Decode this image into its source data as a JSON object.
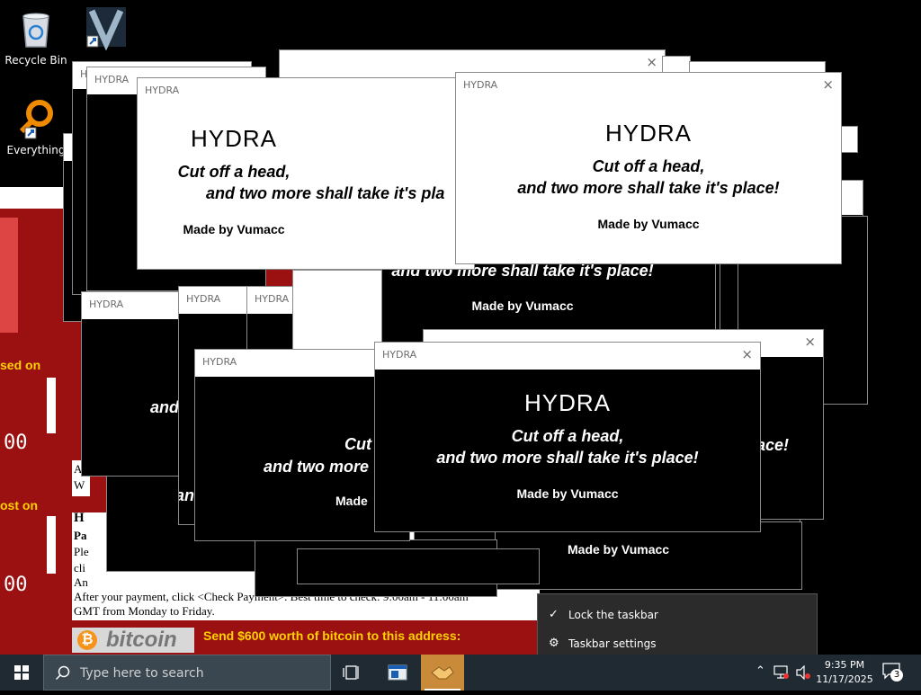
{
  "desktop": {
    "icons": [
      {
        "label": "Recycle Bin",
        "icon": "recycle-bin-icon"
      },
      {
        "label": "",
        "icon": "media-player-shortcut-icon"
      },
      {
        "label": "Everything",
        "icon": "everything-search-icon"
      }
    ]
  },
  "ransom": {
    "raised_label": "sed on",
    "lost_label": "ost on",
    "timer1": "00",
    "timer2": "00",
    "doc_heading": "H",
    "doc_sub": "Pa",
    "doc_lines": [
      "A",
      "W",
      "Ple",
      "cli",
      "An"
    ],
    "doc_payment_line": "After your payment, click <Check Payment>. Best time to check: 9:00am - 11:00am",
    "doc_gmt_line": "GMT from Monday to Friday.",
    "bitcoin_logo": "bitcoin",
    "bitcoin_symbol": "₿",
    "send_text": "Send $600 worth of bitcoin to this address:"
  },
  "hydra": {
    "title_bar": "HYDRA",
    "close": "×",
    "heading": "HYDRA",
    "line1": "Cut off a head,",
    "line2": "and two more shall take it's place!",
    "made_by": "Made by Vumacc",
    "frag_place": "s place!",
    "frag_and_t": "and t",
    "frag_an": "an",
    "frag_cut": "Cut",
    "frag_and_two_more": "and two more",
    "frag_made": "Made",
    "frag_ace": "ace!",
    "frag_line2_partial": "and two more shall take it's pla"
  },
  "context_menu": {
    "items": [
      {
        "label": "Lock the taskbar",
        "icon": "check-icon",
        "glyph": "✓"
      },
      {
        "label": "Taskbar settings",
        "icon": "gear-icon",
        "glyph": "⚙"
      }
    ]
  },
  "taskbar": {
    "search_placeholder": "Type here to search",
    "time": "9:35 PM",
    "date": "11/17/2025",
    "notifications": "3"
  }
}
